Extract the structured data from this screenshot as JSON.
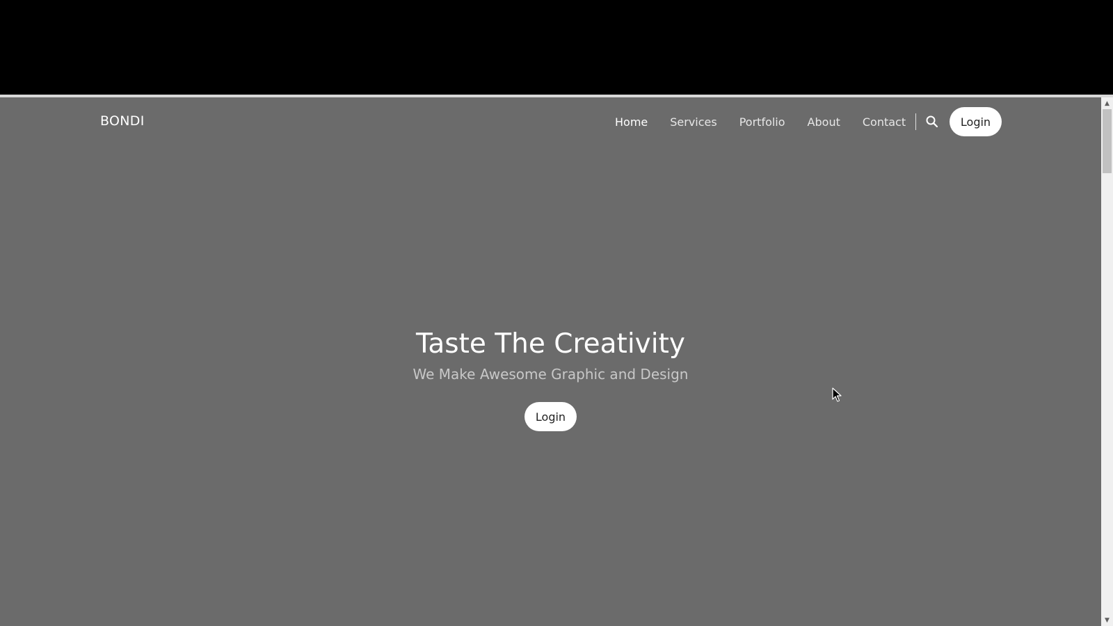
{
  "navbar": {
    "brand": "BONDI",
    "links": [
      {
        "label": "Home",
        "active": true
      },
      {
        "label": "Services",
        "active": false
      },
      {
        "label": "Portfolio",
        "active": false
      },
      {
        "label": "About",
        "active": false
      },
      {
        "label": "Contact",
        "active": false
      }
    ],
    "search_icon": "search-icon",
    "login_label": "Login"
  },
  "hero": {
    "title": "Taste The Creativity",
    "subtitle": "We Make Awesome Graphic and Design",
    "button_label": "Login"
  },
  "colors": {
    "hero_background": "#6b6b6b",
    "button_background": "#ffffff",
    "button_text": "#222222"
  },
  "scrollbar": {
    "up_icon": "triangle-up-icon",
    "down_icon": "triangle-down-icon"
  }
}
